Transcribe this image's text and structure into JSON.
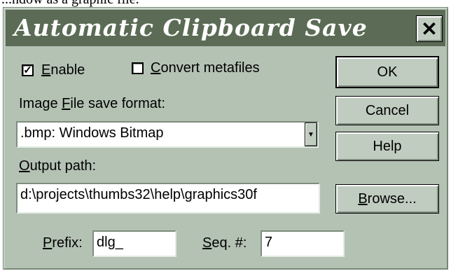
{
  "caption": "...ndow as a graphic file.",
  "window": {
    "title": "Automatic Clipboard Save",
    "close_glyph": "✕"
  },
  "options": {
    "enable": {
      "accel": "E",
      "rest": "nable",
      "checked": true
    },
    "convert_metafiles": {
      "accel": "C",
      "rest": "onvert metafiles",
      "checked": false
    }
  },
  "format": {
    "label_pre": "Image ",
    "label_accel": "F",
    "label_post": "ile save format:",
    "selected": ".bmp: Windows Bitmap"
  },
  "output": {
    "label_accel": "O",
    "label_rest": "utput path:",
    "value": "d:\\projects\\thumbs32\\help\\graphics30f"
  },
  "prefix": {
    "label_accel": "P",
    "label_rest": "refix:",
    "value": "dlg_"
  },
  "seq": {
    "label_accel": "S",
    "label_rest": "eq. #:",
    "value": "7"
  },
  "buttons": {
    "ok": "OK",
    "cancel": "Cancel",
    "help": "Help",
    "browse_accel": "B",
    "browse_rest": "rowse..."
  },
  "icons": {
    "check": "✓",
    "dropdown": "▼"
  },
  "colors": {
    "dialog_bg": "#b4c2b4",
    "titlebar_bg": "#5b6b55",
    "title_text": "#ffffff"
  }
}
